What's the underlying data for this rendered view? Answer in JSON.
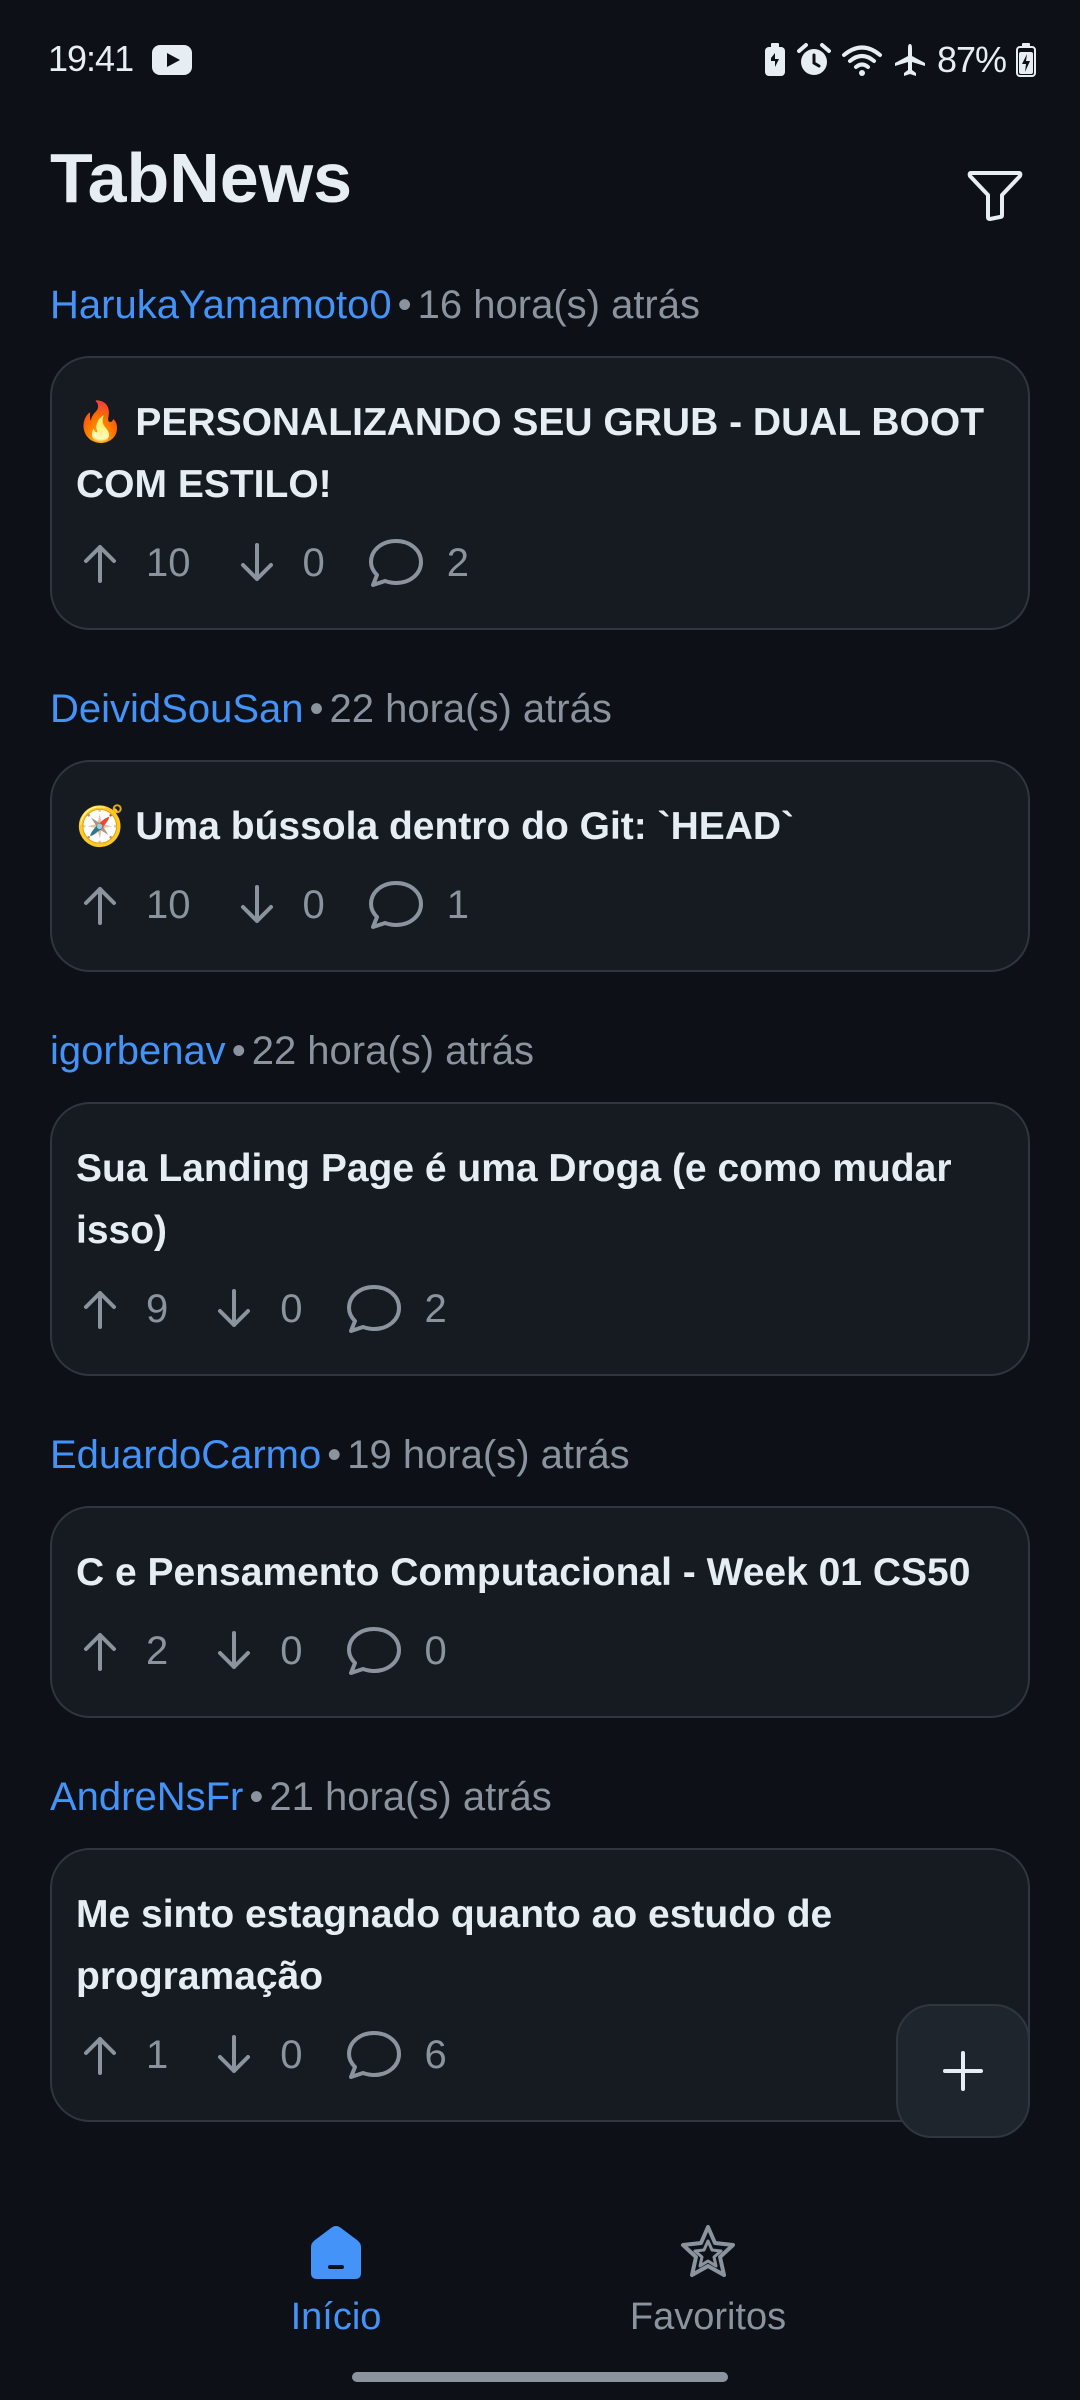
{
  "status_bar": {
    "time": "19:41",
    "battery": "87%"
  },
  "header": {
    "title": "TabNews"
  },
  "posts": [
    {
      "author": "HarukaYamamoto0",
      "time": "16 hora(s) atrás",
      "title": "🔥 PERSONALIZANDO SEU GRUB - DUAL BOOT COM ESTILO!",
      "upvotes": "10",
      "downvotes": "0",
      "comments": "2"
    },
    {
      "author": "DeividSouSan",
      "time": "22 hora(s) atrás",
      "title": "🧭 Uma bússola dentro do Git: `HEAD`",
      "upvotes": "10",
      "downvotes": "0",
      "comments": "1"
    },
    {
      "author": "igorbenav",
      "time": "22 hora(s) atrás",
      "title": "Sua Landing Page é uma Droga (e como mudar isso)",
      "upvotes": "9",
      "downvotes": "0",
      "comments": "2"
    },
    {
      "author": "EduardoCarmo",
      "time": "19 hora(s) atrás",
      "title": "C e Pensamento Computacional - Week 01 CS50",
      "upvotes": "2",
      "downvotes": "0",
      "comments": "0"
    },
    {
      "author": "AndreNsFr",
      "time": "21 hora(s) atrás",
      "title": "Me sinto estagnado quanto ao estudo de programação",
      "upvotes": "1",
      "downvotes": "0",
      "comments": "6"
    }
  ],
  "bottom_nav": {
    "home_label": "Início",
    "favorites_label": "Favoritos"
  },
  "colors": {
    "background": "#0d1117",
    "card": "#161b22",
    "accent": "#4493f8",
    "muted": "#8b949e",
    "text": "#e6edf3"
  },
  "icons": {
    "filter": "filter-icon",
    "upvote": "arrow-up-icon",
    "downvote": "arrow-down-icon",
    "comments": "comment-bubble-icon",
    "fab": "plus-icon",
    "home": "home-icon",
    "favorites": "star-icon"
  }
}
